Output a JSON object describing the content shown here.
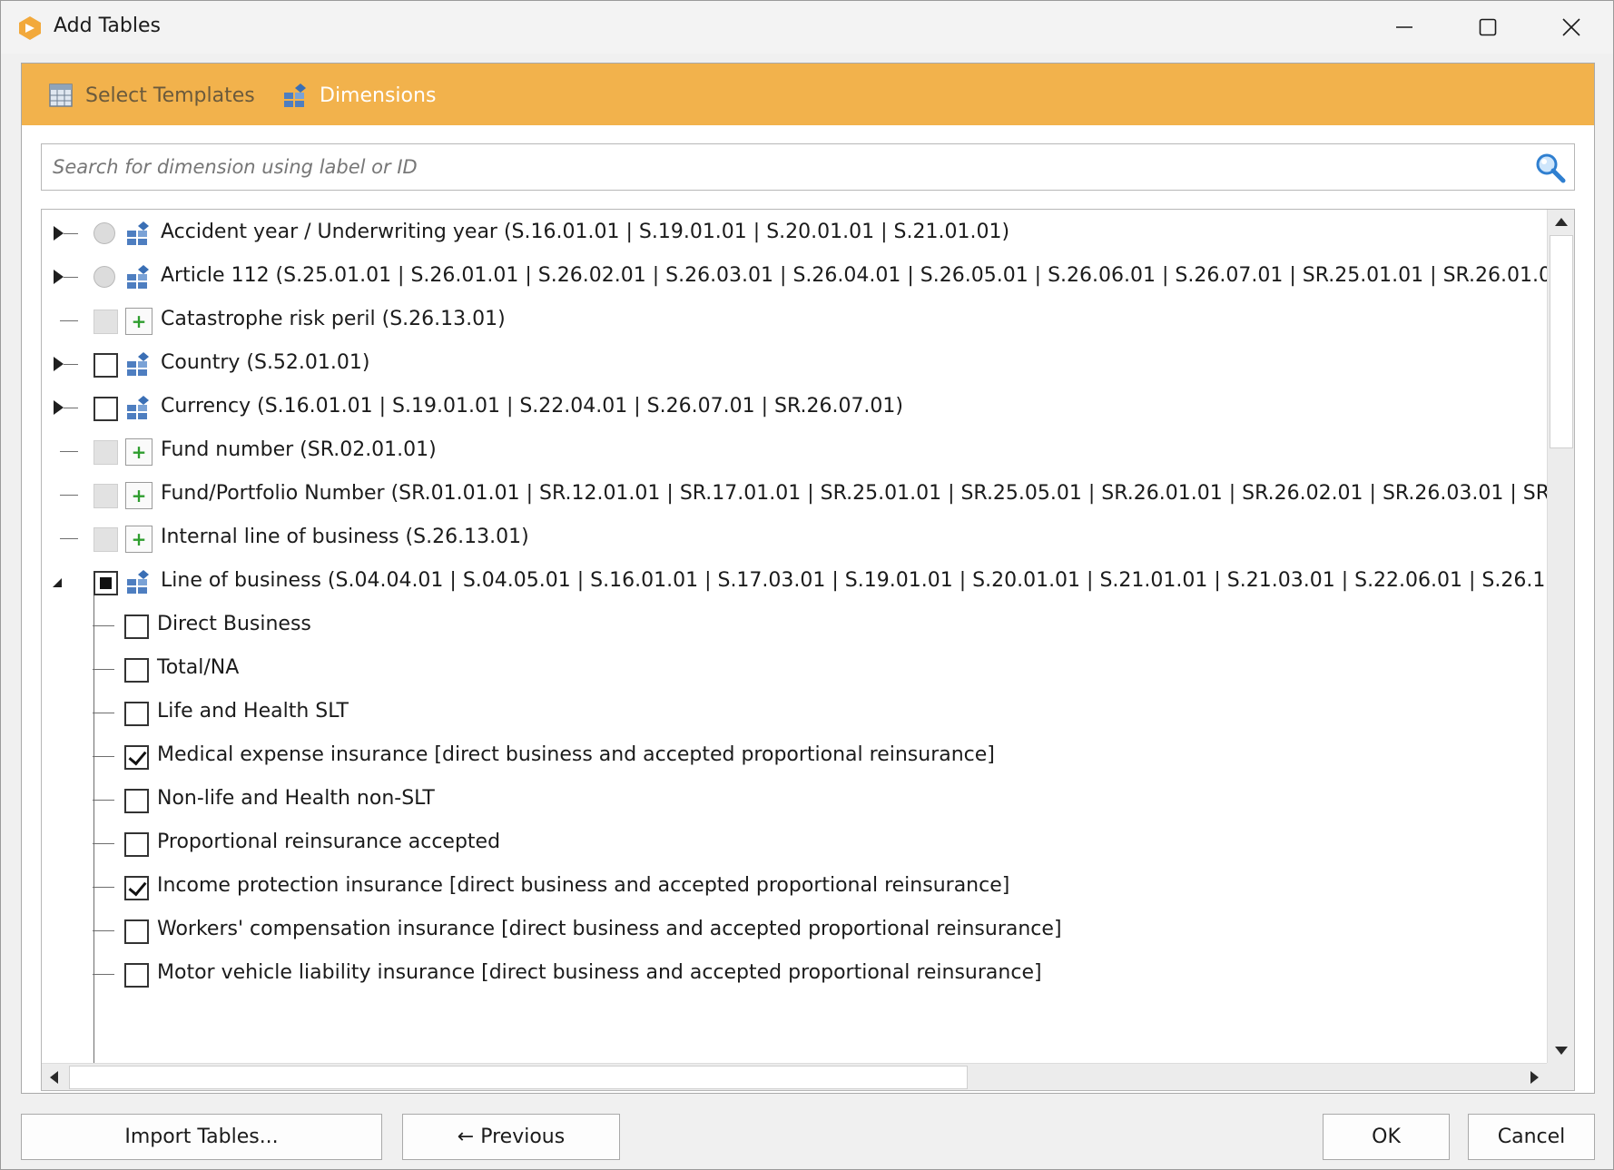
{
  "window": {
    "title": "Add Tables",
    "accent_color": "#f2b24c"
  },
  "wizard": {
    "steps": [
      {
        "label": "Select Templates",
        "icon": "table-grid-icon",
        "active": false
      },
      {
        "label": "Dimensions",
        "icon": "dimension-blocks-icon",
        "active": true
      }
    ]
  },
  "search": {
    "placeholder": "Search for dimension using label or ID",
    "value": "",
    "icon": "search-icon"
  },
  "tree": {
    "items": [
      {
        "label": "Accident year / Underwriting year (S.16.01.01 | S.19.01.01 | S.20.01.01 | S.21.01.01)",
        "selector": "radio",
        "state": "disabled",
        "icon": "dimension-blocks-icon",
        "expandable": true
      },
      {
        "label": "Article 112 (S.25.01.01 | S.26.01.01 | S.26.02.01 | S.26.03.01 | S.26.04.01 | S.26.05.01 | S.26.06.01 | S.26.07.01 | SR.25.01.01 | SR.26.01.01 | SR.26.02.0",
        "selector": "radio",
        "state": "disabled",
        "icon": "dimension-blocks-icon",
        "expandable": true
      },
      {
        "label": "Catastrophe risk peril (S.26.13.01)",
        "selector": "checkbox",
        "state": "disabled",
        "icon": "add-plus-icon",
        "expandable": false
      },
      {
        "label": "Country (S.52.01.01)",
        "selector": "checkbox",
        "state": "unchecked",
        "icon": "dimension-blocks-icon",
        "expandable": true
      },
      {
        "label": "Currency (S.16.01.01 | S.19.01.01 | S.22.04.01 | S.26.07.01 | SR.26.07.01)",
        "selector": "checkbox",
        "state": "unchecked",
        "icon": "dimension-blocks-icon",
        "expandable": true
      },
      {
        "label": "Fund number (SR.02.01.01)",
        "selector": "checkbox",
        "state": "disabled",
        "icon": "add-plus-icon",
        "expandable": false
      },
      {
        "label": "Fund/Portfolio Number (SR.01.01.01 | SR.12.01.01 | SR.17.01.01 | SR.25.01.01 | SR.25.05.01 | SR.26.01.01 | SR.26.02.01 | SR.26.03.01 | SR.26.04.01 |",
        "selector": "checkbox",
        "state": "disabled",
        "icon": "add-plus-icon",
        "expandable": false
      },
      {
        "label": "Internal line of business (S.26.13.01)",
        "selector": "checkbox",
        "state": "disabled",
        "icon": "add-plus-icon",
        "expandable": false
      },
      {
        "label": "Line of business (S.04.04.01 | S.04.05.01 | S.16.01.01 | S.17.03.01 | S.19.01.01 | S.20.01.01 | S.21.01.01 | S.21.03.01 | S.22.06.01 | S.26.13.01 | S.29.04.",
        "selector": "checkbox",
        "state": "partial",
        "icon": "dimension-blocks-icon",
        "expandable": true,
        "expanded": true
      }
    ],
    "children": [
      {
        "label": "Direct Business",
        "checked": false
      },
      {
        "label": "Total/NA",
        "checked": false
      },
      {
        "label": "Life and Health SLT",
        "checked": false
      },
      {
        "label": "Medical expense insurance [direct business and accepted proportional reinsurance]",
        "checked": true
      },
      {
        "label": "Non-life and Health non-SLT",
        "checked": false
      },
      {
        "label": "Proportional reinsurance accepted",
        "checked": false
      },
      {
        "label": "Income protection insurance [direct business and accepted proportional reinsurance]",
        "checked": true
      },
      {
        "label": "Workers' compensation insurance [direct business and accepted proportional reinsurance]",
        "checked": false
      },
      {
        "label": "Motor vehicle liability insurance [direct business and accepted proportional reinsurance]",
        "checked": false
      }
    ]
  },
  "buttons": {
    "import": "Import Tables...",
    "previous": "← Previous",
    "ok": "OK",
    "cancel": "Cancel"
  }
}
